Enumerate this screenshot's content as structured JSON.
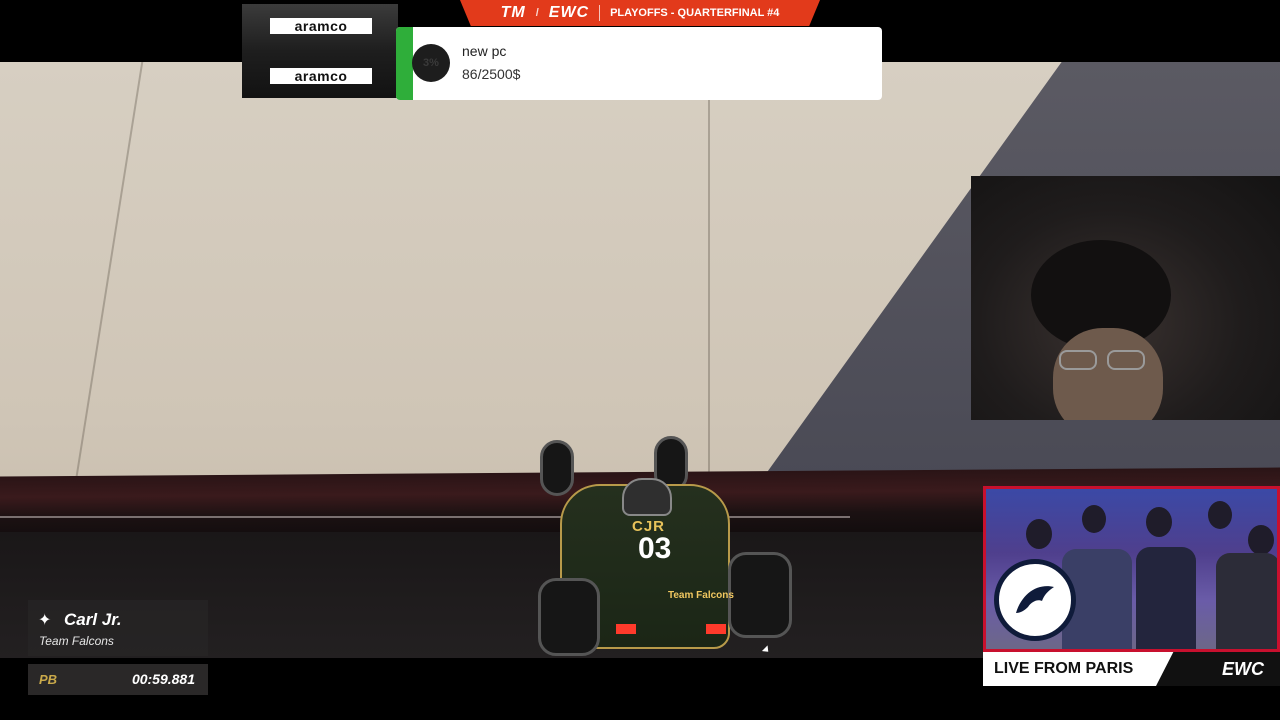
{
  "header": {
    "game_logo": "TM",
    "event_logo": "EWC",
    "stage": "PLAYOFFS - QUARTERFINAL #4"
  },
  "sponsor": {
    "top": "aramco",
    "bottom": "aramco"
  },
  "donation_goal": {
    "percent_label": "3%",
    "progress": 0.034,
    "title": "new pc",
    "amount": "86/2500$",
    "bar_color": "#2fae3a"
  },
  "car": {
    "team_code": "CJR",
    "number": "03",
    "sponsor_text": "Team Falcons"
  },
  "player": {
    "icon": "falcon-icon",
    "name": "Carl Jr.",
    "team": "Team Falcons"
  },
  "personal_best": {
    "label": "PB",
    "time": "00:59.881"
  },
  "live": {
    "text": "LIVE FROM PARIS",
    "logo": "EWC",
    "accent": "#c8102e"
  }
}
